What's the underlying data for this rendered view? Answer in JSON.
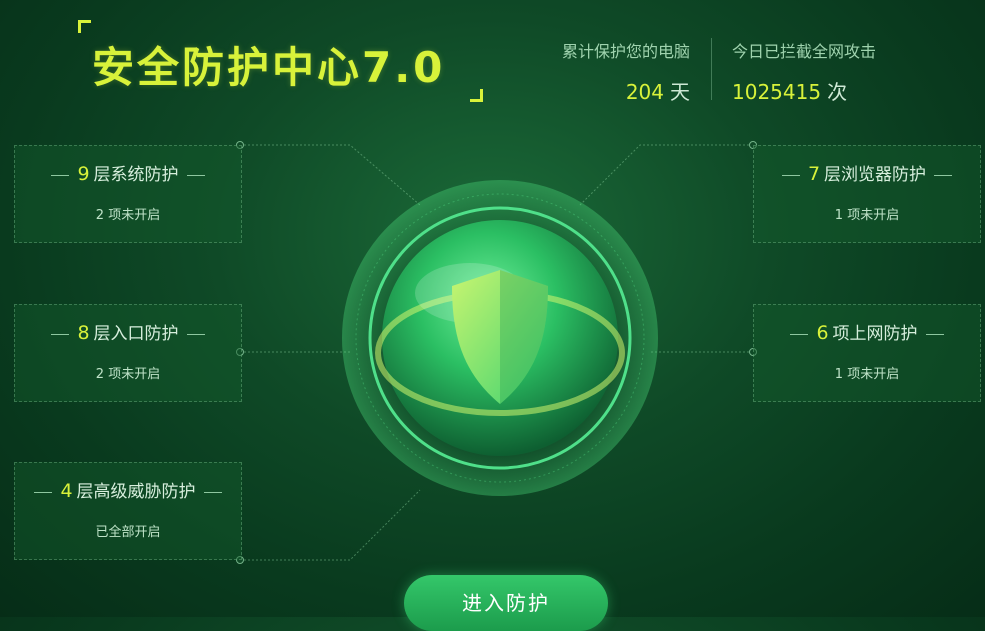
{
  "header": {
    "title": "安全防护中心7.0",
    "stats": [
      {
        "label": "累计保护您的电脑",
        "value": "204",
        "unit": "天"
      },
      {
        "label": "今日已拦截全网攻击",
        "value": "1025415",
        "unit": "次"
      }
    ]
  },
  "cards": {
    "left": [
      {
        "count": "9",
        "name": "层系统防护",
        "status": "2 项未开启"
      },
      {
        "count": "8",
        "name": "层入口防护",
        "status": "2 项未开启"
      },
      {
        "count": "4",
        "name": "层高级威胁防护",
        "status": "已全部开启"
      }
    ],
    "right": [
      {
        "count": "7",
        "name": "层浏览器防护",
        "status": "1 项未开启"
      },
      {
        "count": "6",
        "name": "项上网防护",
        "status": "1 项未开启"
      }
    ]
  },
  "cta": {
    "label": "进入防护"
  },
  "colors": {
    "accent": "#d8f23a",
    "bg": "#0f4a27",
    "button": "#2bb35c"
  },
  "icons": {
    "center": "shield-globe-icon"
  }
}
